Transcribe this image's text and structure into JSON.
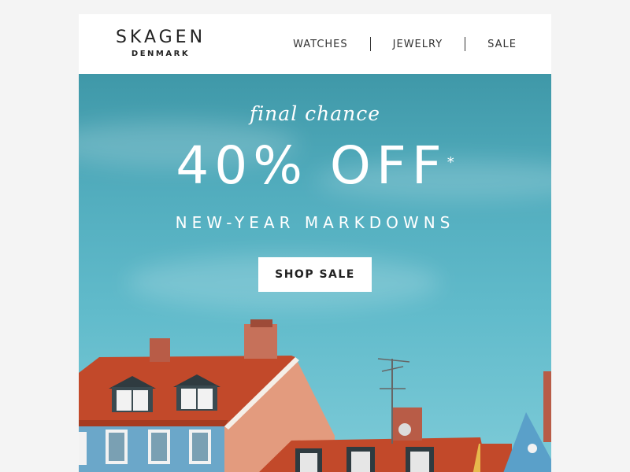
{
  "brand": {
    "name": "SKAGEN",
    "sub": "DENMARK"
  },
  "nav": [
    {
      "label": "WATCHES"
    },
    {
      "label": "JEWELRY"
    },
    {
      "label": "SALE"
    }
  ],
  "hero": {
    "tagline": "final chance",
    "headline": "40% OFF",
    "asterisk": "*",
    "subhead": "NEW-YEAR MARKDOWNS",
    "cta_label": "SHOP SALE"
  },
  "colors": {
    "page_bg": "#f4f4f4",
    "sky": "#52adbe",
    "roof": "#c2492a",
    "wall_blue": "#6ba7c9",
    "wall_peach": "#e39b7e"
  }
}
